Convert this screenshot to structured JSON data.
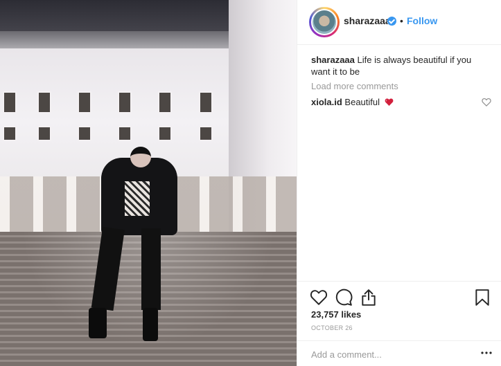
{
  "post": {
    "author": {
      "username": "sharazaaa",
      "verified": true,
      "follow_separator": "•",
      "follow_label": "Follow"
    },
    "caption": {
      "username": "sharazaaa",
      "text": "Life is always beautiful if you want it to be"
    },
    "load_more_label": "Load more comments",
    "comments": [
      {
        "username": "xiola.id",
        "text": "Beautiful",
        "emoji": "red-heart-icon"
      }
    ],
    "likes_text": "23,757 likes",
    "date": "OCTOBER 26",
    "add_comment": {
      "placeholder": "Add a comment..."
    },
    "icons": [
      "heart-icon",
      "comment-icon",
      "share-icon",
      "bookmark-icon",
      "verified-badge-icon",
      "more-icon"
    ],
    "colors": {
      "link": "#3897f0",
      "muted": "#999999",
      "border": "#efefef",
      "text": "#262626"
    }
  }
}
